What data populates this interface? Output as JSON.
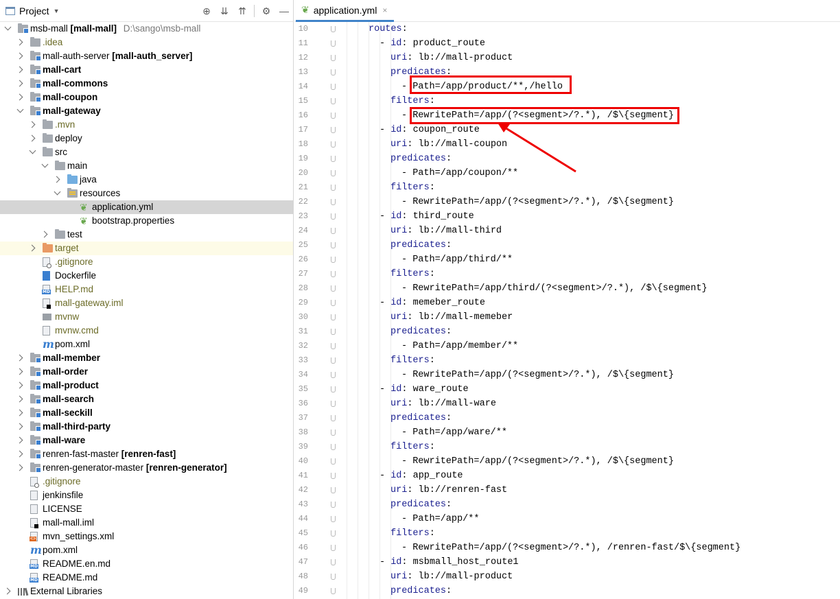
{
  "project_panel": {
    "title": "Project",
    "tools": [
      "target-icon",
      "expand-all-icon",
      "collapse-all-icon",
      "gear-icon",
      "minimize-icon"
    ]
  },
  "tree": [
    {
      "indent": 0,
      "arrow": "open",
      "icon": "module-folder",
      "parts": [
        {
          "t": "msb-mall "
        },
        {
          "t": "[mall-mall]",
          "b": true
        },
        {
          "t": "  D:\\sango\\msb-mall",
          "c": "path"
        }
      ]
    },
    {
      "indent": 1,
      "arrow": "closed",
      "icon": "folder",
      "parts": [
        {
          "t": ".idea",
          "c": "olive"
        }
      ]
    },
    {
      "indent": 1,
      "arrow": "closed",
      "icon": "module-folder",
      "parts": [
        {
          "t": "mall-auth-server "
        },
        {
          "t": "[mall-auth_server]",
          "b": true
        }
      ]
    },
    {
      "indent": 1,
      "arrow": "closed",
      "icon": "module-folder",
      "parts": [
        {
          "t": "mall-cart",
          "b": true
        }
      ]
    },
    {
      "indent": 1,
      "arrow": "closed",
      "icon": "module-folder",
      "parts": [
        {
          "t": "mall-commons",
          "b": true
        }
      ]
    },
    {
      "indent": 1,
      "arrow": "closed",
      "icon": "module-folder",
      "parts": [
        {
          "t": "mall-coupon",
          "b": true
        }
      ]
    },
    {
      "indent": 1,
      "arrow": "open",
      "icon": "module-folder",
      "parts": [
        {
          "t": "mall-gateway",
          "b": true
        }
      ]
    },
    {
      "indent": 2,
      "arrow": "closed",
      "icon": "folder",
      "parts": [
        {
          "t": ".mvn",
          "c": "olive"
        }
      ]
    },
    {
      "indent": 2,
      "arrow": "closed",
      "icon": "folder",
      "parts": [
        {
          "t": "deploy"
        }
      ]
    },
    {
      "indent": 2,
      "arrow": "open",
      "icon": "folder",
      "parts": [
        {
          "t": "src"
        }
      ]
    },
    {
      "indent": 3,
      "arrow": "open",
      "icon": "folder",
      "parts": [
        {
          "t": "main"
        }
      ]
    },
    {
      "indent": 4,
      "arrow": "closed",
      "icon": "source-folder",
      "parts": [
        {
          "t": "java"
        }
      ]
    },
    {
      "indent": 4,
      "arrow": "open",
      "icon": "resources-folder",
      "parts": [
        {
          "t": "resources"
        }
      ]
    },
    {
      "indent": 5,
      "arrow": "none",
      "icon": "spring-leaf",
      "state": "selected",
      "parts": [
        {
          "t": "application.yml"
        }
      ]
    },
    {
      "indent": 5,
      "arrow": "none",
      "icon": "spring-leaf",
      "parts": [
        {
          "t": "bootstrap.properties"
        }
      ]
    },
    {
      "indent": 3,
      "arrow": "closed",
      "icon": "folder",
      "parts": [
        {
          "t": "test"
        }
      ]
    },
    {
      "indent": 2,
      "arrow": "closed",
      "icon": "excluded-folder",
      "state": "excluded",
      "parts": [
        {
          "t": "target",
          "c": "olive"
        }
      ]
    },
    {
      "indent": 2,
      "arrow": "none",
      "icon": "ignore-file",
      "parts": [
        {
          "t": ".gitignore",
          "c": "olive"
        }
      ]
    },
    {
      "indent": 2,
      "arrow": "none",
      "icon": "docker-file",
      "parts": [
        {
          "t": "Dockerfile"
        }
      ]
    },
    {
      "indent": 2,
      "arrow": "none",
      "icon": "md-file",
      "parts": [
        {
          "t": "HELP.md",
          "c": "olive"
        }
      ]
    },
    {
      "indent": 2,
      "arrow": "none",
      "icon": "iml-file",
      "parts": [
        {
          "t": "mall-gateway.iml",
          "c": "olive"
        }
      ]
    },
    {
      "indent": 2,
      "arrow": "none",
      "icon": "script-file",
      "parts": [
        {
          "t": "mvnw",
          "c": "olive"
        }
      ]
    },
    {
      "indent": 2,
      "arrow": "none",
      "icon": "text-file",
      "parts": [
        {
          "t": "mvnw.cmd",
          "c": "olive"
        }
      ]
    },
    {
      "indent": 2,
      "arrow": "none",
      "icon": "maven-icon",
      "parts": [
        {
          "t": "pom.xml"
        }
      ]
    },
    {
      "indent": 1,
      "arrow": "closed",
      "icon": "module-folder",
      "parts": [
        {
          "t": "mall-member",
          "b": true
        }
      ]
    },
    {
      "indent": 1,
      "arrow": "closed",
      "icon": "module-folder",
      "parts": [
        {
          "t": "mall-order",
          "b": true
        }
      ]
    },
    {
      "indent": 1,
      "arrow": "closed",
      "icon": "module-folder",
      "parts": [
        {
          "t": "mall-product",
          "b": true
        }
      ]
    },
    {
      "indent": 1,
      "arrow": "closed",
      "icon": "module-folder",
      "parts": [
        {
          "t": "mall-search",
          "b": true
        }
      ]
    },
    {
      "indent": 1,
      "arrow": "closed",
      "icon": "module-folder",
      "parts": [
        {
          "t": "mall-seckill",
          "b": true
        }
      ]
    },
    {
      "indent": 1,
      "arrow": "closed",
      "icon": "module-folder",
      "parts": [
        {
          "t": "mall-third-party",
          "b": true
        }
      ]
    },
    {
      "indent": 1,
      "arrow": "closed",
      "icon": "module-folder",
      "parts": [
        {
          "t": "mall-ware",
          "b": true
        }
      ]
    },
    {
      "indent": 1,
      "arrow": "closed",
      "icon": "module-folder",
      "parts": [
        {
          "t": "renren-fast-master "
        },
        {
          "t": "[renren-fast]",
          "b": true
        }
      ]
    },
    {
      "indent": 1,
      "arrow": "closed",
      "icon": "module-folder",
      "parts": [
        {
          "t": "renren-generator-master "
        },
        {
          "t": "[renren-generator]",
          "b": true
        }
      ]
    },
    {
      "indent": 1,
      "arrow": "none",
      "icon": "ignore-file",
      "parts": [
        {
          "t": ".gitignore",
          "c": "olive"
        }
      ]
    },
    {
      "indent": 1,
      "arrow": "none",
      "icon": "text-file",
      "parts": [
        {
          "t": "jenkinsfile"
        }
      ]
    },
    {
      "indent": 1,
      "arrow": "none",
      "icon": "text-file",
      "parts": [
        {
          "t": "LICENSE"
        }
      ]
    },
    {
      "indent": 1,
      "arrow": "none",
      "icon": "iml-file",
      "parts": [
        {
          "t": "mall-mall.iml"
        }
      ]
    },
    {
      "indent": 1,
      "arrow": "none",
      "icon": "xml-file",
      "parts": [
        {
          "t": "mvn_settings.xml"
        }
      ]
    },
    {
      "indent": 1,
      "arrow": "none",
      "icon": "maven-icon",
      "parts": [
        {
          "t": "pom.xml"
        }
      ]
    },
    {
      "indent": 1,
      "arrow": "none",
      "icon": "md-file",
      "parts": [
        {
          "t": "README.en.md"
        }
      ]
    },
    {
      "indent": 1,
      "arrow": "none",
      "icon": "md-file",
      "parts": [
        {
          "t": "README.md"
        }
      ]
    },
    {
      "indent": 0,
      "arrow": "closed",
      "icon": "libraries-icon",
      "parts": [
        {
          "t": "External Libraries"
        }
      ]
    }
  ],
  "editor": {
    "tab_label": "application.yml",
    "tab_close": "×",
    "lines": [
      {
        "n": 10,
        "k": "routes",
        "v": "",
        "ind": 2
      },
      {
        "n": 11,
        "k": "id",
        "v": "product_route",
        "ind": 3,
        "dash": true
      },
      {
        "n": 12,
        "k": "uri",
        "v": "lb://mall-product",
        "ind": 4
      },
      {
        "n": 13,
        "k": "predicates",
        "v": "",
        "ind": 4
      },
      {
        "n": 14,
        "k": "",
        "v": "Path=/app/product/**,/hello",
        "ind": 5,
        "dash": true
      },
      {
        "n": 15,
        "k": "filters",
        "v": "",
        "ind": 4
      },
      {
        "n": 16,
        "k": "",
        "v": "RewritePath=/app/(?<segment>/?.*), /$\\{segment}",
        "ind": 5,
        "dash": true
      },
      {
        "n": 17,
        "k": "id",
        "v": "coupon_route",
        "ind": 3,
        "dash": true
      },
      {
        "n": 18,
        "k": "uri",
        "v": "lb://mall-coupon",
        "ind": 4
      },
      {
        "n": 19,
        "k": "predicates",
        "v": "",
        "ind": 4
      },
      {
        "n": 20,
        "k": "",
        "v": "Path=/app/coupon/**",
        "ind": 5,
        "dash": true
      },
      {
        "n": 21,
        "k": "filters",
        "v": "",
        "ind": 4
      },
      {
        "n": 22,
        "k": "",
        "v": "RewritePath=/app/(?<segment>/?.*), /$\\{segment}",
        "ind": 5,
        "dash": true
      },
      {
        "n": 23,
        "k": "id",
        "v": "third_route",
        "ind": 3,
        "dash": true
      },
      {
        "n": 24,
        "k": "uri",
        "v": "lb://mall-third",
        "ind": 4
      },
      {
        "n": 25,
        "k": "predicates",
        "v": "",
        "ind": 4
      },
      {
        "n": 26,
        "k": "",
        "v": "Path=/app/third/**",
        "ind": 5,
        "dash": true
      },
      {
        "n": 27,
        "k": "filters",
        "v": "",
        "ind": 4
      },
      {
        "n": 28,
        "k": "",
        "v": "RewritePath=/app/third/(?<segment>/?.*), /$\\{segment}",
        "ind": 5,
        "dash": true
      },
      {
        "n": 29,
        "k": "id",
        "v": "memeber_route",
        "ind": 3,
        "dash": true
      },
      {
        "n": 30,
        "k": "uri",
        "v": "lb://mall-memeber",
        "ind": 4
      },
      {
        "n": 31,
        "k": "predicates",
        "v": "",
        "ind": 4
      },
      {
        "n": 32,
        "k": "",
        "v": "Path=/app/member/**",
        "ind": 5,
        "dash": true
      },
      {
        "n": 33,
        "k": "filters",
        "v": "",
        "ind": 4
      },
      {
        "n": 34,
        "k": "",
        "v": "RewritePath=/app/(?<segment>/?.*), /$\\{segment}",
        "ind": 5,
        "dash": true
      },
      {
        "n": 35,
        "k": "id",
        "v": "ware_route",
        "ind": 3,
        "dash": true
      },
      {
        "n": 36,
        "k": "uri",
        "v": "lb://mall-ware",
        "ind": 4
      },
      {
        "n": 37,
        "k": "predicates",
        "v": "",
        "ind": 4
      },
      {
        "n": 38,
        "k": "",
        "v": "Path=/app/ware/**",
        "ind": 5,
        "dash": true
      },
      {
        "n": 39,
        "k": "filters",
        "v": "",
        "ind": 4
      },
      {
        "n": 40,
        "k": "",
        "v": "RewritePath=/app/(?<segment>/?.*), /$\\{segment}",
        "ind": 5,
        "dash": true
      },
      {
        "n": 41,
        "k": "id",
        "v": "app_route",
        "ind": 3,
        "dash": true
      },
      {
        "n": 42,
        "k": "uri",
        "v": "lb://renren-fast",
        "ind": 4
      },
      {
        "n": 43,
        "k": "predicates",
        "v": "",
        "ind": 4
      },
      {
        "n": 44,
        "k": "",
        "v": "Path=/app/**",
        "ind": 5,
        "dash": true
      },
      {
        "n": 45,
        "k": "filters",
        "v": "",
        "ind": 4
      },
      {
        "n": 46,
        "k": "",
        "v": "RewritePath=/app/(?<segment>/?.*), /renren-fast/$\\{segment}",
        "ind": 5,
        "dash": true
      },
      {
        "n": 47,
        "k": "id",
        "v": "msbmall_host_route1",
        "ind": 3,
        "dash": true
      },
      {
        "n": 48,
        "k": "uri",
        "v": "lb://mall-product",
        "ind": 4
      },
      {
        "n": 49,
        "k": "predicates",
        "v": "",
        "ind": 4
      }
    ]
  },
  "annotations": {
    "highlight_color": "#e00000",
    "highlighted_lines": [
      14,
      16
    ],
    "arrow_target_line": 16
  },
  "colors": {
    "yaml_key": "#1a1f8f",
    "selection": "#d5d5d5",
    "excluded_row": "#fdfbe7",
    "tab_underline": "#4083c9"
  }
}
